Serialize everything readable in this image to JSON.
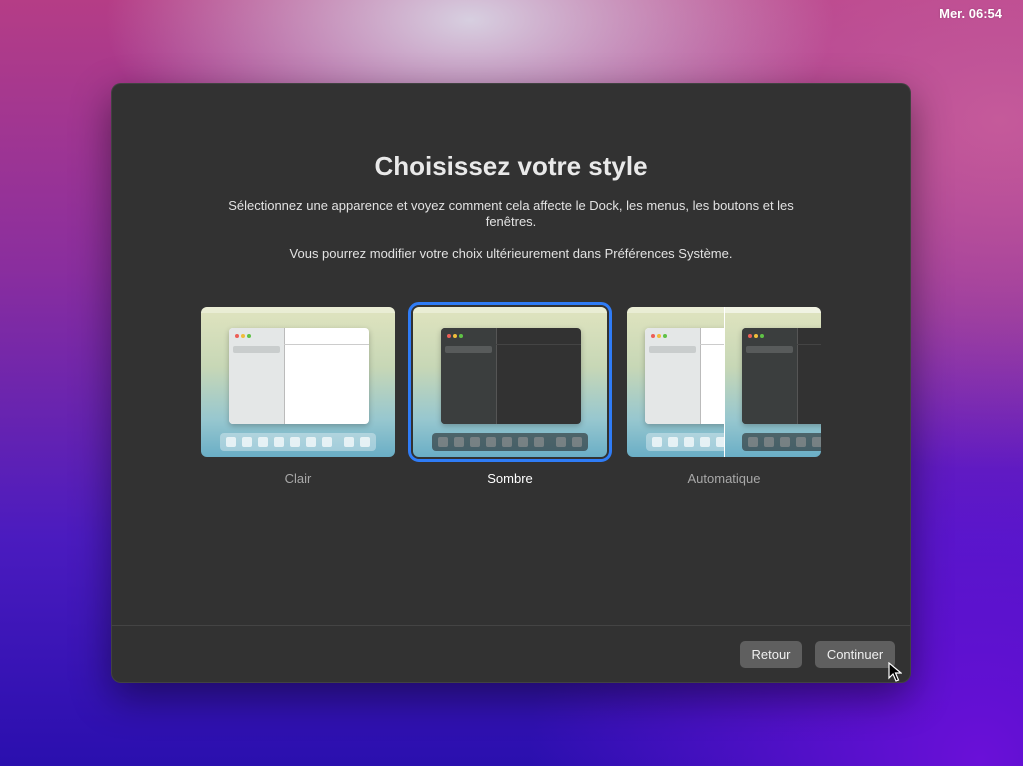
{
  "menubar": {
    "clock": "Mer. 06:54"
  },
  "dialog": {
    "title": "Choisissez votre style",
    "description": "Sélectionnez une apparence et voyez comment cela affecte le Dock, les menus, les boutons et les fenêtres.",
    "note": "Vous pourrez modifier votre choix ultérieurement dans Préférences Système.",
    "options": [
      {
        "label": "Clair",
        "selected": false
      },
      {
        "label": "Sombre",
        "selected": true
      },
      {
        "label": "Automatique",
        "selected": false
      }
    ],
    "buttons": {
      "back": "Retour",
      "continue": "Continuer"
    }
  },
  "colors": {
    "accent": "#2f7cf6",
    "window_bg": "#323232",
    "button_bg": "#5f5f5f"
  }
}
